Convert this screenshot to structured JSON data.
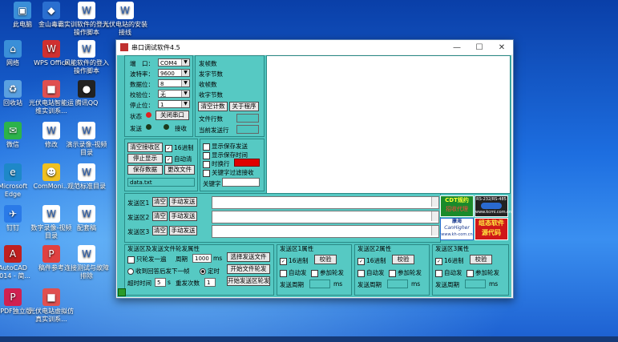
{
  "desktop": {
    "icons": [
      {
        "label": "此电脑",
        "icon": "computer-icon",
        "color": "#3a8fd8"
      },
      {
        "label": "金山毒霸",
        "icon": "antivirus-icon",
        "color": "#2a6fd0"
      },
      {
        "label": "实训软件的登入操作脚本",
        "icon": "document-icon",
        "color": "#ffffff"
      },
      {
        "label": "光伏电站的安装接线",
        "icon": "document-icon",
        "color": "#ffffff"
      },
      {
        "label": "网络",
        "icon": "network-icon",
        "color": "#3a8fd8"
      },
      {
        "label": "WPS Office",
        "icon": "wps-icon",
        "color": "#d03030"
      },
      {
        "label": "风能软件的登入操作脚本",
        "icon": "document-icon",
        "color": "#ffffff"
      },
      {
        "label": "回收站",
        "icon": "recycle-bin-icon",
        "color": "#5aa0e0"
      },
      {
        "label": "光伏电站智能运维实训系...",
        "icon": "app-icon",
        "color": "#e05050"
      },
      {
        "label": "腾讯QQ",
        "icon": "qq-icon",
        "color": "#222222"
      },
      {
        "label": "微信",
        "icon": "wechat-icon",
        "color": "#2cb34a"
      },
      {
        "label": "修改",
        "icon": "document-icon",
        "color": "#ffffff"
      },
      {
        "label": "演示录像-视频目录",
        "icon": "document-icon",
        "color": "#ffffff"
      },
      {
        "label": "Microsoft Edge",
        "icon": "edge-icon",
        "color": "#1e88c8"
      },
      {
        "label": "ComMoni...",
        "icon": "commonitor-icon",
        "color": "#f0c020"
      },
      {
        "label": "观范标准目录",
        "icon": "document-icon",
        "color": "#ffffff"
      },
      {
        "label": "钉钉",
        "icon": "dingtalk-icon",
        "color": "#2a7ae8"
      },
      {
        "label": "数字录像-视频目录",
        "icon": "document-icon",
        "color": "#ffffff"
      },
      {
        "label": "配套稿",
        "icon": "document-icon",
        "color": "#ffffff"
      },
      {
        "label": "AutoCAD 2014 - 简...",
        "icon": "autocad-icon",
        "color": "#c02020"
      },
      {
        "label": "稿件参考",
        "icon": "pdf-icon",
        "color": "#e04040"
      },
      {
        "label": "连接测试与故障排除",
        "icon": "document-icon",
        "color": "#ffffff"
      },
      {
        "label": "山PDF独立版",
        "icon": "pdf-icon",
        "color": "#d02050"
      },
      {
        "label": "光伏电站虚拟仿真实训系...",
        "icon": "app-icon",
        "color": "#e05050"
      }
    ]
  },
  "window": {
    "title": "串口调试软件4.5",
    "minimize": "—",
    "maximize": "☐",
    "close": "✕"
  },
  "port_settings": {
    "port_label": "端　口：",
    "port_value": "COM4",
    "baud_label": "波特率：",
    "baud_value": "9600",
    "data_label": "数据位：",
    "data_value": "8",
    "parity_label": "校验位：",
    "parity_value": "无",
    "stop_label": "停止位：",
    "stop_value": "1",
    "status_label": "状态",
    "close_port_button": "关闭串口",
    "send_label": "发送",
    "recv_label": "接收"
  },
  "counters": {
    "send_frames": "发帧数",
    "send_bytes": "发字节数",
    "recv_frames": "收帧数",
    "recv_bytes": "收字节数",
    "clear_count_button": "清空计数",
    "about_button": "关于程序",
    "file_lines": "文件行数",
    "current_send_line": "当前发送行"
  },
  "receive_controls": {
    "clear_recv_button": "清空接收区",
    "hex_label": "16进制",
    "stop_display_button": "停止显示",
    "auto_clear_label": "自动清",
    "save_data_button": "保存数据",
    "change_file_button": "更改文件",
    "file_name": "data.txt"
  },
  "display_options": {
    "show_save_send": "显示保存发送",
    "show_save_time": "显示保存时间",
    "timed_line_break": "时换行",
    "timed_value": "",
    "keyword_filter": "关键字过滤接收",
    "keyword_label": "关键字",
    "keyword_value": ""
  },
  "send_areas": [
    {
      "label": "发送区1",
      "clear": "清空",
      "manual": "手动发送"
    },
    {
      "label": "发送区2",
      "clear": "清空",
      "manual": "手动发送"
    },
    {
      "label": "发送区3",
      "clear": "清空",
      "manual": "手动发送"
    }
  ],
  "ads": {
    "cdt_title": "CDT规约",
    "cdt_sub": "招收代理",
    "canhigher_title": "康海",
    "canhigher_brand": "CanHigher",
    "canhigher_url": "www.kh-com.cn",
    "converter_title": "RS-232/RS-485",
    "converter_url": "www.kcmi.com.cn",
    "config_line1": "组态软件",
    "config_line2": "源代码"
  },
  "send_file_settings": {
    "title": "发送区及发送文件轮发属性",
    "send_once_label": "只轮发一遍",
    "period_label": "周期",
    "period_value": "1000",
    "period_unit": "ms",
    "select_file_button": "选择发送文件",
    "on_reply_label": "收到回答后发下一帧",
    "timed_label": "定时",
    "start_file_button": "开始文件轮发",
    "timeout_label": "超时时间",
    "timeout_value": "5",
    "timeout_unit": "s",
    "retry_label": "重发次数",
    "retry_value": "1",
    "start_area_button": "开始发送区轮发"
  },
  "area_props": [
    {
      "title": "发送区1属性",
      "hex": "16进制",
      "verify": "校验",
      "auto_send": "自动发",
      "join_cycle": "参加轮发",
      "period": "发送周期",
      "unit": "ms"
    },
    {
      "title": "发送区2属性",
      "hex": "16进制",
      "verify": "校验",
      "auto_send": "自动发",
      "join_cycle": "参加轮发",
      "period": "发送周期",
      "unit": "ms"
    },
    {
      "title": "发送区3属性",
      "hex": "16进制",
      "verify": "校验",
      "auto_send": "自动发",
      "join_cycle": "参加轮发",
      "period": "发送周期",
      "unit": "ms"
    }
  ],
  "colors": {
    "client_bg": "#4fc4be",
    "status_led": "#e02020",
    "timed_value_bg": "#e00000"
  }
}
